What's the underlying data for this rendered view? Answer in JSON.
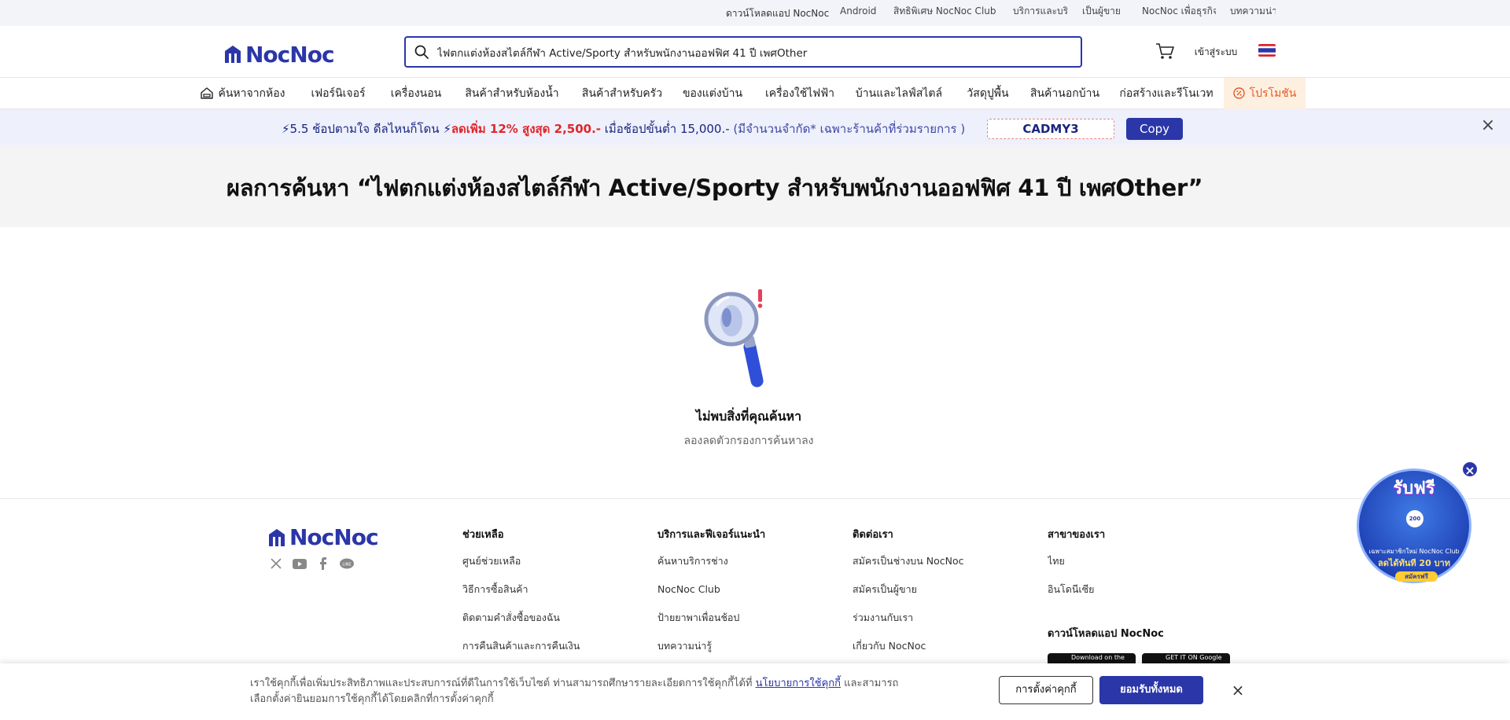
{
  "topbar": {
    "download_app": "ดาวน์โหลดแอป NocNoc",
    "links": [
      "Android",
      "สิทธิพิเศษ NocNoc Club",
      "บริการและบริการ",
      "เป็นผู้ขาย",
      "NocNoc เพื่อธุรกิจ",
      "บทความน่ารู้"
    ]
  },
  "header": {
    "logo_text": "NocNoc",
    "search_value": "ไฟตกแต่งห้องสไตล์กีฬา Active/Sporty สำหรับพนักงานออฟฟิศ 41 ปี เพศOther",
    "login_label": "เข้าสู่ระบบ",
    "icons": {
      "search": "search-icon",
      "cart": "cart-icon",
      "flag": "thai-flag-icon"
    }
  },
  "categories": [
    {
      "label": "ค้นหาจากห้อง",
      "icon": "room-icon"
    },
    {
      "label": "เฟอร์นิเจอร์"
    },
    {
      "label": "เครื่องนอน"
    },
    {
      "label": "สินค้าสำหรับห้องน้ำ"
    },
    {
      "label": "สินค้าสำหรับครัว"
    },
    {
      "label": "ของแต่งบ้าน"
    },
    {
      "label": "เครื่องใช้ไฟฟ้า"
    },
    {
      "label": "บ้านและไลฟ์สไตล์"
    },
    {
      "label": "วัสดุปูพื้น"
    },
    {
      "label": "สินค้านอกบ้าน"
    },
    {
      "label": "ก่อสร้างและรีโนเวท"
    },
    {
      "label": "โปรโมชัน",
      "icon": "promo-icon"
    }
  ],
  "banner": {
    "part1": "⚡5.5 ช้อปตามใจ ดีลไหนก็โดน ⚡",
    "part2": "ลดเพิ่ม 12% สูงสุด 2,500.-",
    "part3": " เมื่อช้อปขั้นต่ำ 15,000.-",
    "part4": "  (มีจำนวนจำกัด* เฉพาะร้านค้าที่ร่วมรายการ )",
    "code": "CADMY3",
    "copy_label": "Copy",
    "close": "×"
  },
  "results": {
    "title": "ผลการค้นหา “ไฟตกแต่งห้องสไตล์กีฬา Active/Sporty สำหรับพนักงานออฟฟิศ 41 ปี เพศOther”"
  },
  "empty_state": {
    "title": "ไม่พบสิ่งที่คุณค้นหา",
    "subtitle": "ลองลดตัวกรองการค้นหาลง"
  },
  "footer": {
    "logo_text": "NocNoc",
    "socials": [
      "x-icon",
      "youtube-icon",
      "facebook-icon",
      "line-icon"
    ],
    "columns": [
      {
        "heading": "ช่วยเหลือ",
        "links": [
          "ศูนย์ช่วยเหลือ",
          "วิธีการซื้อสินค้า",
          "ติดตามคำสั่งซื้อของฉัน",
          "การคืนสินค้าและการคืนเงิน"
        ]
      },
      {
        "heading": "บริการและฟีเจอร์แนะนำ",
        "links": [
          "ค้นหาบริการช่าง",
          "NocNoc Club",
          "ป้ายยาพาเพื่อนช้อป",
          "บทความน่ารู้"
        ]
      },
      {
        "heading": "ติดต่อเรา",
        "links": [
          "สมัครเป็นช่างบน NocNoc",
          "สมัครเป็นผู้ขาย",
          "ร่วมงานกับเรา",
          "เกี่ยวกับ NocNoc"
        ]
      },
      {
        "heading": "สาขาของเรา",
        "links": [
          "ไทย",
          "อินโดนีเซีย"
        ]
      }
    ],
    "download_app": "ดาวน์โหลดแอป NocNoc",
    "store_badges": [
      "Download on the App Store",
      "GET IT ON Google Play"
    ]
  },
  "float_promo": {
    "title": "รับฟรี",
    "coin": "200",
    "line1": "เฉพาะสมาชิกใหม่ NocNoc Club",
    "line2": "ลดได้ทันที 20 บาท",
    "button": "สมัครฟรี",
    "close": "×"
  },
  "cookie": {
    "text_before": "เราใช้คุกกี้เพื่อเพิ่มประสิทธิภาพและประสบการณ์ที่ดีในการใช้เว็บไซต์ ท่านสามารถศึกษารายละเอียดการใช้คุกกี้ได้ที่ ",
    "link": "นโยบายการใช้คุกกี้",
    "text_after": " และสามารถเลือกตั้งค่ายินยอมการใช้คุกกี้ได้โดยคลิกที่การตั้งค่าคุกกี้",
    "settings_label": "การตั้งค่าคุกกี้",
    "accept_label": "ยอมรับทั้งหมด",
    "close": "×"
  },
  "colors": {
    "brand": "#2b36a8",
    "promo_bg": "#fdf0e1",
    "promo_text": "#e25b28",
    "banner_red": "#e0262b"
  }
}
